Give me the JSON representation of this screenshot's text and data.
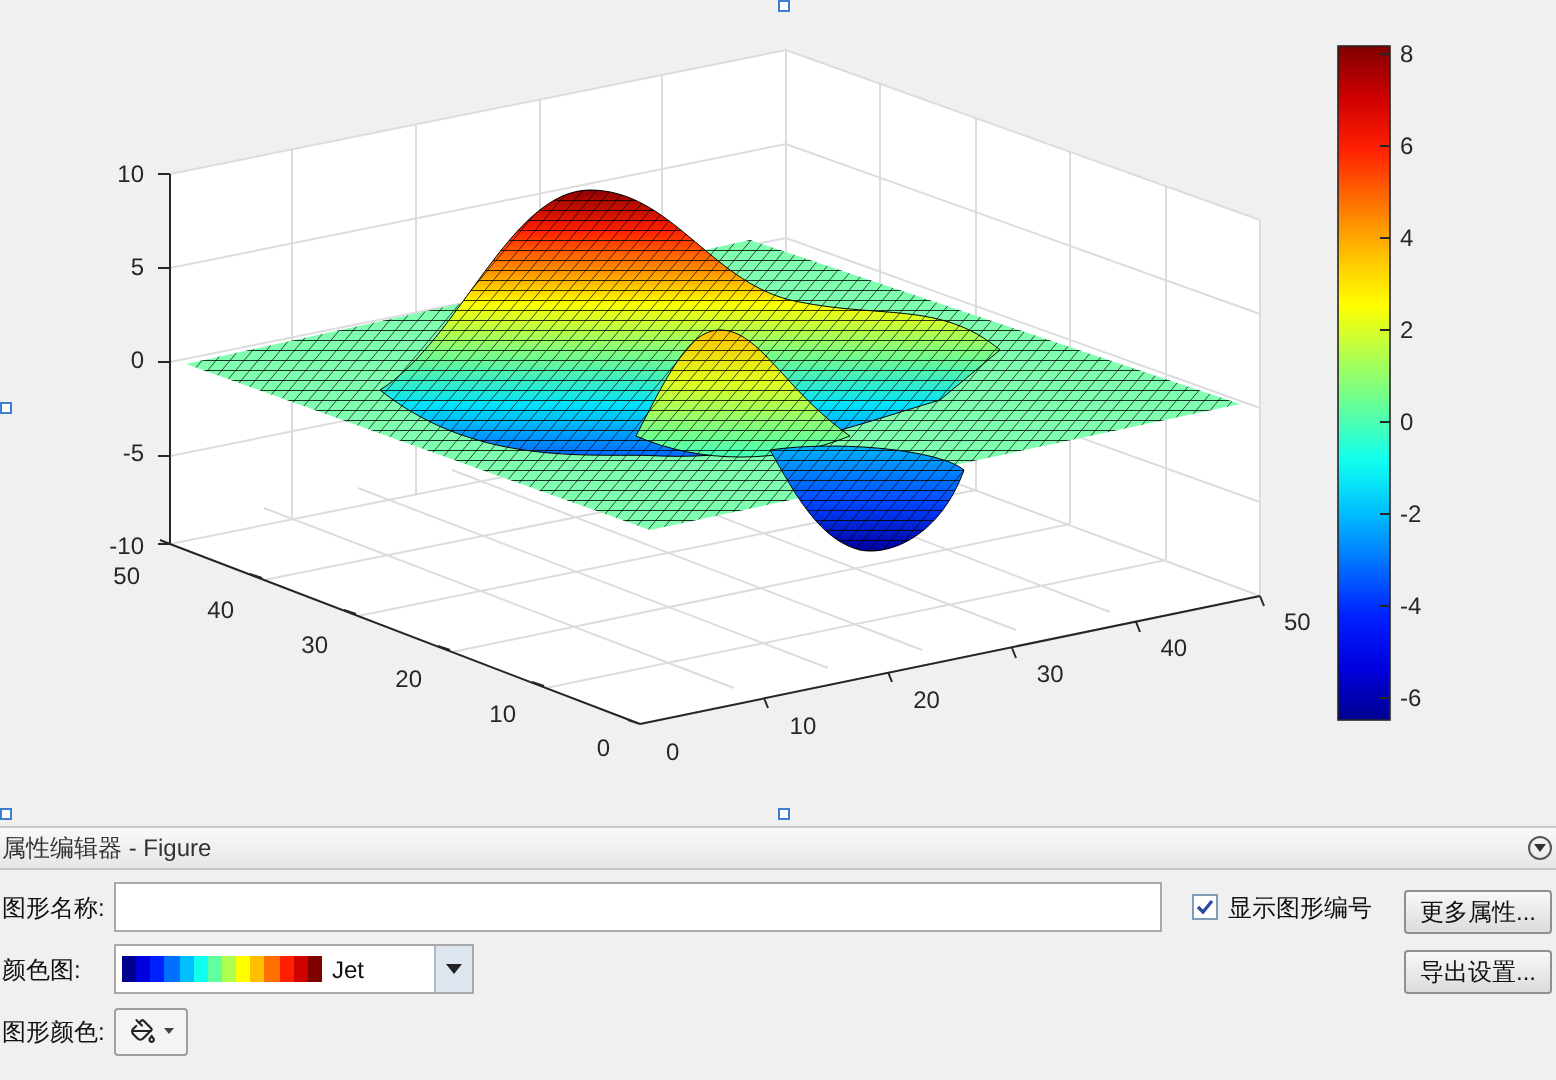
{
  "figure": {
    "axes": {
      "z_ticks": [
        "10",
        "5",
        "0",
        "-5",
        "-10"
      ],
      "y_ticks": [
        "50",
        "40",
        "30",
        "20",
        "10",
        "0"
      ],
      "x_ticks": [
        "0",
        "10",
        "20",
        "30",
        "40",
        "50"
      ]
    },
    "colorbar": {
      "ticks": [
        "8",
        "6",
        "4",
        "2",
        "0",
        "-2",
        "-4",
        "-6"
      ]
    }
  },
  "property_editor": {
    "title": "属性编辑器 - Figure",
    "name_label": "图形名称:",
    "show_number": {
      "label": "显示图形编号",
      "checked": true
    },
    "colormap": {
      "label": "颜色图:",
      "value": "Jet"
    },
    "color_label": "图形颜色:",
    "buttons": [
      "更多属性...",
      "导出设置..."
    ]
  }
}
